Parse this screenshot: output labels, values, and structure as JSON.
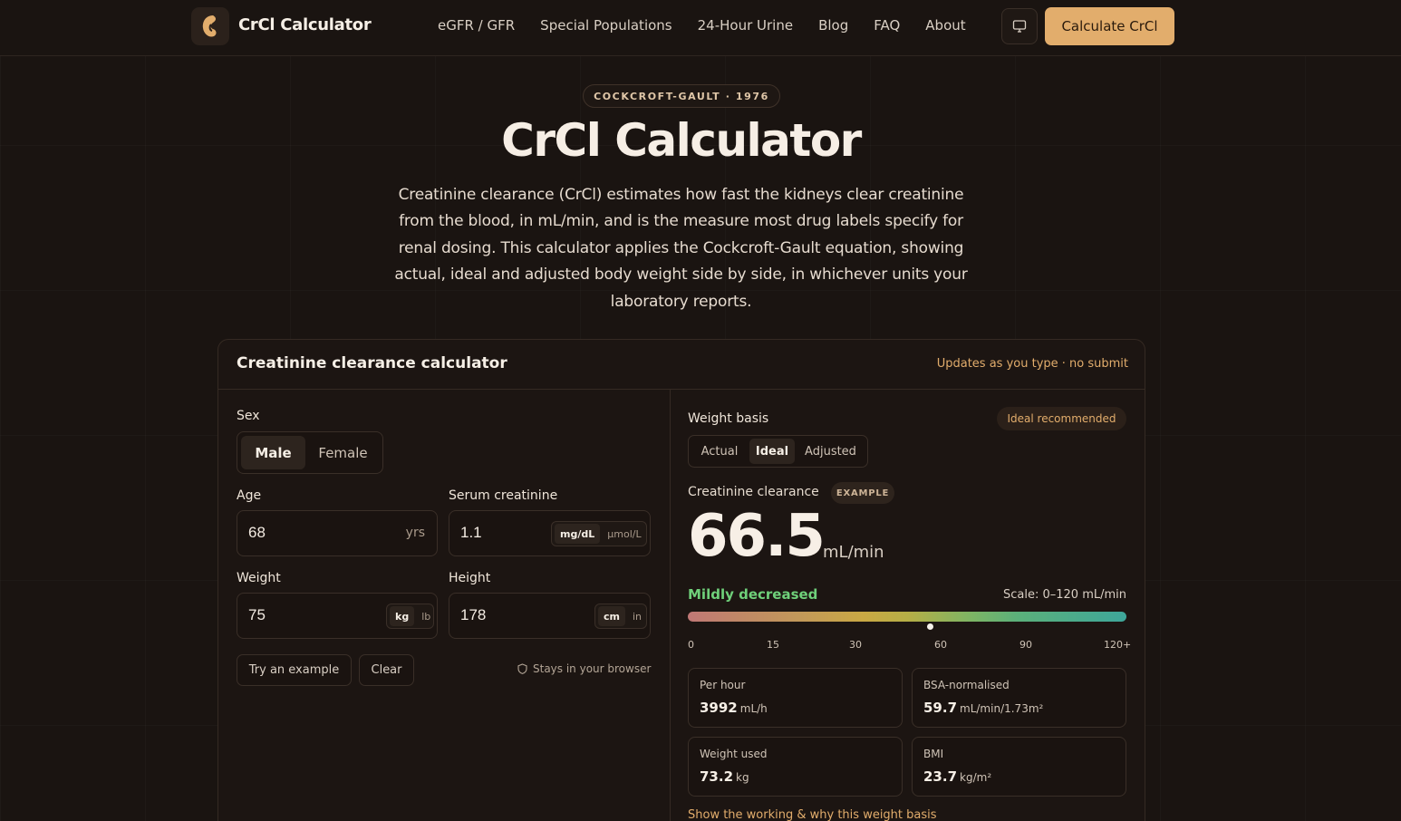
{
  "nav": {
    "brand": "CrCl Calculator",
    "links": [
      "eGFR / GFR",
      "Special Populations",
      "24-Hour Urine",
      "Blog",
      "FAQ",
      "About"
    ],
    "cta": "Calculate CrCl"
  },
  "hero": {
    "eyebrow": "COCKCROFT-GAULT · 1976",
    "title": "CrCl Calculator",
    "description": "Creatinine clearance (CrCl) estimates how fast the kidneys clear creatinine from the blood, in mL/min, and is the measure most drug labels specify for renal dosing. This calculator applies the Cockcroft-Gault equation, showing actual, ideal and adjusted body weight side by side, in whichever units your laboratory reports."
  },
  "calculator": {
    "title": "Creatinine clearance calculator",
    "note": "Updates as you type · no submit",
    "sex": {
      "label": "Sex",
      "options": [
        "Male",
        "Female"
      ],
      "selected": "Male"
    },
    "age": {
      "label": "Age",
      "value": "68",
      "unit": "yrs"
    },
    "creatinine": {
      "label": "Serum creatinine",
      "value": "1.1",
      "units": [
        "mg/dL",
        "μmol/L"
      ],
      "selected": "mg/dL"
    },
    "weight": {
      "label": "Weight",
      "value": "75",
      "units": [
        "kg",
        "lb"
      ],
      "selected": "kg"
    },
    "height": {
      "label": "Height",
      "value": "178",
      "units": [
        "cm",
        "in"
      ],
      "selected": "cm"
    },
    "try_example": "Try an example",
    "clear": "Clear",
    "privacy": "Stays in your browser"
  },
  "result": {
    "weight_basis": {
      "label": "Weight basis",
      "badge": "Ideal recommended",
      "options": [
        "Actual",
        "Ideal",
        "Adjusted"
      ],
      "selected": "Ideal"
    },
    "label": "Creatinine clearance",
    "example_badge": "EXAMPLE",
    "value": "66.5",
    "unit": "mL/min",
    "status": "Mildly decreased",
    "scale_note": "Scale: 0–120 mL/min",
    "scale_max": 120,
    "marker_value": 66.5,
    "ticks": [
      "0",
      "15",
      "30",
      "60",
      "90",
      "120+"
    ],
    "stats": [
      {
        "label": "Per hour",
        "value": "3992",
        "unit": "mL/h"
      },
      {
        "label": "BSA-normalised",
        "value": "59.7",
        "unit": "mL/min/1.73m²"
      },
      {
        "label": "Weight used",
        "value": "73.2",
        "unit": "kg"
      },
      {
        "label": "BMI",
        "value": "23.7",
        "unit": "kg/m²"
      }
    ],
    "show_working": "Show the working & why this weight basis"
  },
  "colors": {
    "accent": "#e2ad6c",
    "status_green": "#6fd07a",
    "background": "#1a1411"
  }
}
